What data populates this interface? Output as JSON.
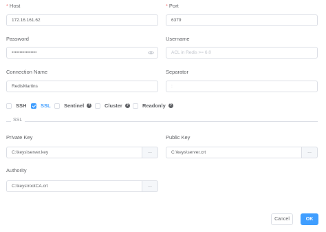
{
  "host": {
    "label": "Host",
    "value": "172.16.161.62"
  },
  "port": {
    "label": "Port",
    "value": "6379"
  },
  "password": {
    "label": "Password",
    "value": "••••••••••••••••"
  },
  "username": {
    "label": "Username",
    "placeholder": "ACL in Redis >= 6.0"
  },
  "connection_name": {
    "label": "Connection Name",
    "value": "RedisMartins"
  },
  "separator": {
    "label": "Separator",
    "value": ":"
  },
  "options": {
    "ssh": {
      "label": "SSH",
      "checked": false
    },
    "ssl": {
      "label": "SSL",
      "checked": true
    },
    "sentinel": {
      "label": "Sentinel",
      "checked": false,
      "help_icon": "question-circle-icon"
    },
    "cluster": {
      "label": "Cluster",
      "checked": false,
      "help_icon": "question-circle-icon"
    },
    "readonly": {
      "label": "Readonly",
      "checked": false,
      "help_icon": "question-circle-icon"
    }
  },
  "ssl_section": {
    "title": "SSL",
    "private_key": {
      "label": "Private Key",
      "value": "C:\\keys\\server.key",
      "browse_label": "..."
    },
    "public_key": {
      "label": "Public Key",
      "value": "C:\\keys\\server.crt",
      "browse_label": "..."
    },
    "authority": {
      "label": "Authority",
      "value": "C:\\keys\\rootCA.crt",
      "browse_label": "..."
    }
  },
  "footer": {
    "cancel_label": "Cancel",
    "ok_label": "OK"
  },
  "colors": {
    "accent": "#409eff",
    "required": "#f56c6c",
    "border": "#dcdfe6"
  }
}
